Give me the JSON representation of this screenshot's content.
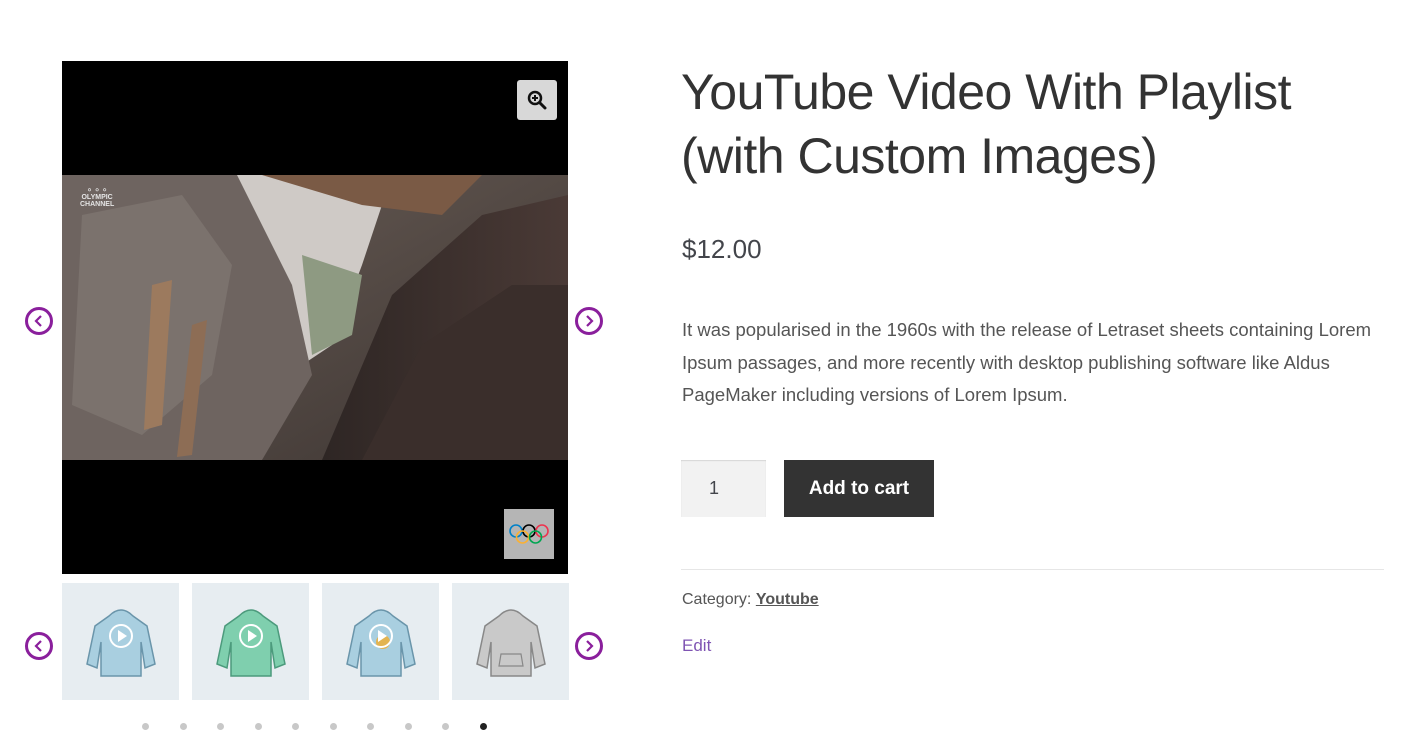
{
  "product": {
    "title": "YouTube Video With Playlist (with Custom Images)",
    "price": "$12.00",
    "description": "It was popularised in the 1960s with the release of Letraset sheets containing Lorem Ipsum passages, and more recently with desktop publishing software like Aldus PageMaker including versions of Lorem Ipsum.",
    "quantity": "1",
    "add_to_cart_label": "Add to cart",
    "category_label": "Category:",
    "category": "Youtube",
    "edit_label": "Edit"
  },
  "gallery": {
    "channel_watermark_line1": "OLYMPIC",
    "channel_watermark_line2": "CHANNEL",
    "zoom_icon": "magnifier-plus-icon",
    "logo_icon": "olympic-rings-icon",
    "thumbnails": [
      {
        "name": "thumb-hoodie-blue-play",
        "color": "#a9cfe0",
        "play": true
      },
      {
        "name": "thumb-hoodie-green-play",
        "color": "#7fcfae",
        "play": true
      },
      {
        "name": "thumb-hoodie-blue-logo",
        "color": "#a9cfe0",
        "play": true
      },
      {
        "name": "thumb-hoodie-grey",
        "color": "#c9c9c9",
        "play": false
      }
    ],
    "dot_count": 10,
    "active_dot": 9
  },
  "colors": {
    "arrow": "#8a1f9c",
    "link": "#7f54b3",
    "button": "#333333"
  }
}
